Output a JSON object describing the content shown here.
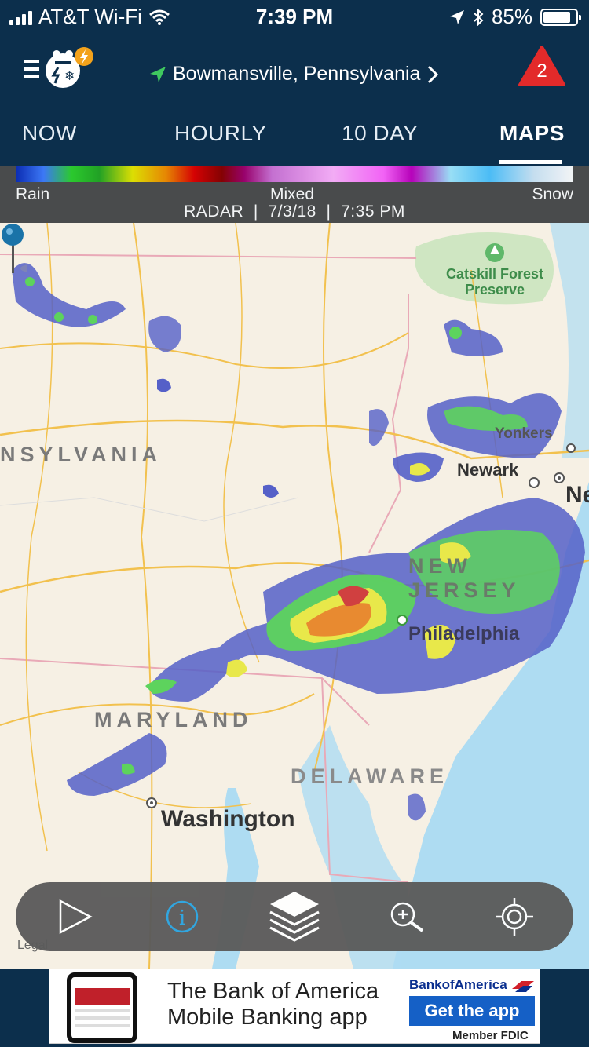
{
  "status_bar": {
    "carrier": "AT&T Wi-Fi",
    "time": "7:39 PM",
    "battery_percent": "85%",
    "battery_level": 0.85
  },
  "header": {
    "location": "Bowmansville, Pennsylvania",
    "alert_count": "2",
    "alert_color": "#e32a2a"
  },
  "tabs": [
    {
      "label": "NOW"
    },
    {
      "label": "HOURLY"
    },
    {
      "label": "10 DAY"
    },
    {
      "label": "MAPS"
    }
  ],
  "active_tab": "MAPS",
  "legend": {
    "rain_label": "Rain",
    "mixed_label": "Mixed",
    "snow_label": "Snow",
    "subtitle": "RADAR  |  7/3/18  |  7:35 PM"
  },
  "map": {
    "labels": {
      "state_pa": "NSYLVANIA",
      "state_md": "MARYLAND",
      "state_de": "DELAWARE",
      "state_nj": "NEW JERSEY",
      "city_washington": "Washington",
      "city_philadelphia": "Philadelphia",
      "city_newark": "Newark",
      "city_yonkers": "Yonkers",
      "city_ny": "Ne",
      "park": "Catskill Forest Preserve"
    },
    "legal_link": "Legal"
  },
  "controls": {
    "play": "play-icon",
    "info": "info-icon",
    "layers": "layers-icon",
    "zoom": "zoom-in-icon",
    "locate": "locate-icon"
  },
  "ad": {
    "text_line1": "The Bank of America",
    "text_line2": "Mobile Banking app",
    "brand": "BankofAmerica",
    "button": "Get the app",
    "fdic": "Member FDIC"
  },
  "colors": {
    "header_bg": "#0c2f4c",
    "map_land": "#f6f0e4",
    "water": "#aedcf2",
    "radar_blue": "#5560c8",
    "radar_green": "#5dd35d",
    "radar_yellow": "#e8e84a",
    "radar_orange": "#e88a30",
    "radar_red": "#d04040"
  }
}
